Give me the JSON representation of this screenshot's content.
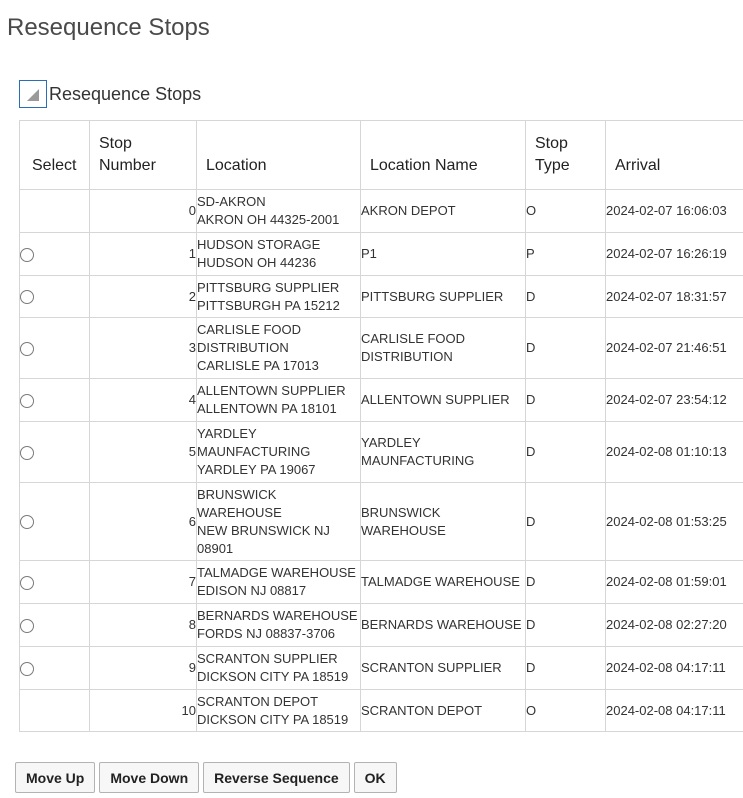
{
  "page": {
    "title": "Resequence Stops"
  },
  "region": {
    "title": "Resequence Stops",
    "toggle_icon": "collapse-triangle-icon"
  },
  "table": {
    "headers": {
      "select": "Select",
      "stop_number": "Stop Number",
      "location": "Location",
      "location_name": "Location Name",
      "stop_type": "Stop Type",
      "arrival": "Arrival"
    },
    "rows": [
      {
        "selectable": false,
        "stop_number": "0",
        "location": [
          "SD-AKRON",
          "AKRON OH 44325-2001"
        ],
        "location_name": "AKRON DEPOT",
        "stop_type": "O",
        "arrival": "2024-02-07 16:06:03"
      },
      {
        "selectable": true,
        "stop_number": "1",
        "location": [
          "HUDSON STORAGE",
          "HUDSON OH 44236"
        ],
        "location_name": "P1",
        "stop_type": "P",
        "arrival": "2024-02-07 16:26:19"
      },
      {
        "selectable": true,
        "stop_number": "2",
        "location": [
          "PITTSBURG SUPPLIER",
          "PITTSBURGH PA 15212"
        ],
        "location_name": "PITTSBURG SUPPLIER",
        "stop_type": "D",
        "arrival": "2024-02-07 18:31:57"
      },
      {
        "selectable": true,
        "stop_number": "3",
        "location": [
          "CARLISLE FOOD",
          "DISTRIBUTION",
          "CARLISLE PA 17013"
        ],
        "location_name": "CARLISLE FOOD DISTRIBUTION",
        "stop_type": "D",
        "arrival": "2024-02-07 21:46:51"
      },
      {
        "selectable": true,
        "stop_number": "4",
        "location": [
          "ALLENTOWN SUPPLIER",
          "ALLENTOWN PA 18101"
        ],
        "location_name": "ALLENTOWN SUPPLIER",
        "stop_type": "D",
        "arrival": "2024-02-07 23:54:12"
      },
      {
        "selectable": true,
        "stop_number": "5",
        "location": [
          "YARDLEY",
          "MAUNFACTURING",
          "YARDLEY PA 19067"
        ],
        "location_name": "YARDLEY MAUNFACTURING",
        "stop_type": "D",
        "arrival": "2024-02-08 01:10:13"
      },
      {
        "selectable": true,
        "stop_number": "6",
        "location": [
          "BRUNSWICK",
          "WAREHOUSE",
          "NEW BRUNSWICK NJ",
          "08901"
        ],
        "location_name": "BRUNSWICK WAREHOUSE",
        "stop_type": "D",
        "arrival": "2024-02-08 01:53:25"
      },
      {
        "selectable": true,
        "stop_number": "7",
        "location": [
          "TALMADGE WAREHOUSE",
          "EDISON NJ 08817"
        ],
        "location_name": "TALMADGE WAREHOUSE",
        "stop_type": "D",
        "arrival": "2024-02-08 01:59:01"
      },
      {
        "selectable": true,
        "stop_number": "8",
        "location": [
          "BERNARDS WAREHOUSE",
          "FORDS NJ 08837-3706"
        ],
        "location_name": "BERNARDS WAREHOUSE",
        "stop_type": "D",
        "arrival": "2024-02-08 02:27:20"
      },
      {
        "selectable": true,
        "stop_number": "9",
        "location": [
          "SCRANTON SUPPLIER",
          "DICKSON CITY PA 18519"
        ],
        "location_name": "SCRANTON SUPPLIER",
        "stop_type": "D",
        "arrival": "2024-02-08 04:17:11"
      },
      {
        "selectable": false,
        "stop_number": "10",
        "location": [
          "SCRANTON DEPOT",
          "DICKSON CITY PA 18519"
        ],
        "location_name": "SCRANTON DEPOT",
        "stop_type": "O",
        "arrival": "2024-02-08 04:17:11"
      }
    ]
  },
  "buttons": {
    "move_up": "Move Up",
    "move_down": "Move Down",
    "reverse_sequence": "Reverse Sequence",
    "ok": "OK"
  },
  "colors": {
    "toggle_border": "#2a6fb5",
    "grid_line": "#d6d6d6"
  }
}
